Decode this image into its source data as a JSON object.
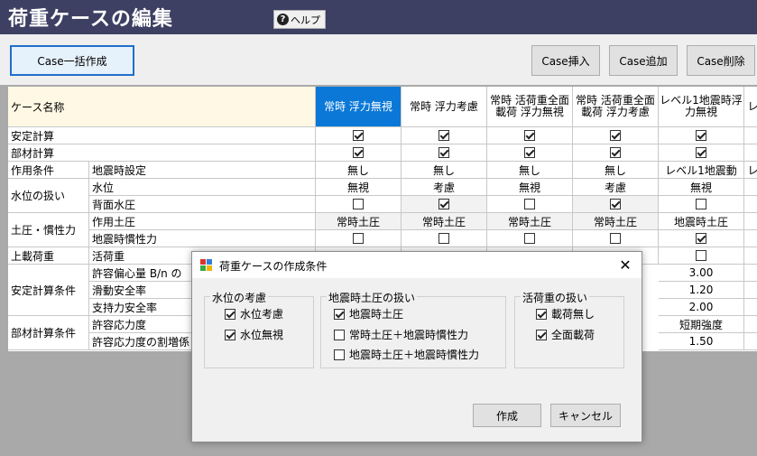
{
  "window": {
    "title": "荷重ケースの編集",
    "help_label": "ヘルプ"
  },
  "toolbar": {
    "bulk_create": "Case一括作成",
    "insert": "Case挿入",
    "add": "Case追加",
    "delete": "Case削除"
  },
  "grid": {
    "header_label": "ケース名称",
    "columns": [
      "常時 浮力無視",
      "常時 浮力考慮",
      "常時 活荷重全面載荷 浮力無視",
      "常時 活荷重全面載荷 浮力考慮",
      "レベル1地震時浮力無視",
      "レ"
    ],
    "rows": {
      "stability": "安定計算",
      "member": "部材計算",
      "action_cond": "作用条件",
      "eq_setting": "地震時設定",
      "water": "水位の扱い",
      "water_level": "水位",
      "back_water": "背面水圧",
      "soil": "土圧・慣性力",
      "action_soil": "作用土圧",
      "eq_inertia": "地震時慣性力",
      "surcharge": "上載荷重",
      "live_load": "活荷重",
      "stab_cond": "安定計算条件",
      "allow_ecc": "許容偏心量 B/n の",
      "sliding": "滑動安全率",
      "bearing": "支持力安全率",
      "member_cond": "部材計算条件",
      "allow_stress": "許容応力度",
      "allow_stress_inc": "許容応力度の割増係"
    },
    "values": {
      "eq_setting": [
        "無し",
        "無し",
        "無し",
        "無し",
        "レベル1地震動",
        "レ"
      ],
      "water_level": [
        "無視",
        "考慮",
        "無視",
        "考慮",
        "無視",
        ""
      ],
      "action_soil": [
        "常時土圧",
        "常時土圧",
        "常時土圧",
        "常時土圧",
        "地震時土圧",
        ""
      ],
      "col5_allow_ecc": "3.00",
      "col5_sliding": "1.20",
      "col5_bearing": "2.00",
      "col5_allow_stress": "短期強度",
      "col5_allow_stress_inc": "1.50"
    },
    "checks": {
      "stability": [
        true,
        true,
        true,
        true,
        true
      ],
      "member": [
        true,
        true,
        true,
        true,
        true
      ],
      "back_water": [
        false,
        true,
        false,
        true,
        false
      ],
      "eq_inertia": [
        false,
        false,
        false,
        false,
        true
      ],
      "live_load": [
        false
      ]
    }
  },
  "dialog": {
    "title": "荷重ケースの作成条件",
    "groups": {
      "water": {
        "title": "水位の考慮",
        "options": [
          {
            "label": "水位考慮",
            "checked": true
          },
          {
            "label": "水位無視",
            "checked": true
          }
        ]
      },
      "eq_soil": {
        "title": "地震時土圧の扱い",
        "options": [
          {
            "label": "地震時土圧",
            "checked": true
          },
          {
            "label": "常時土圧＋地震時慣性力",
            "checked": false
          },
          {
            "label": "地震時土圧＋地震時慣性力",
            "checked": false
          }
        ]
      },
      "live": {
        "title": "活荷重の扱い",
        "options": [
          {
            "label": "載荷無し",
            "checked": true
          },
          {
            "label": "全面載荷",
            "checked": true
          }
        ]
      }
    },
    "create_label": "作成",
    "cancel_label": "キャンセル"
  }
}
